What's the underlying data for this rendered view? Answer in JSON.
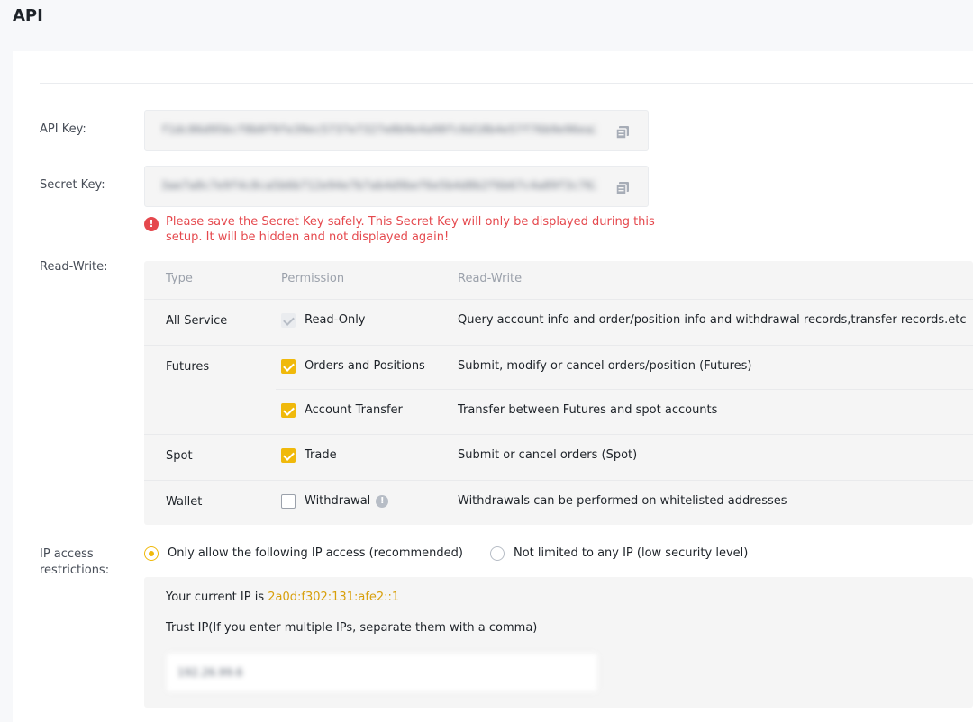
{
  "page": {
    "title": "API"
  },
  "keys": {
    "api_key_label": "API Key:",
    "api_key_value": "f1dc86d95bcf8b0f9fe39ec5737e7327e0b9e4a98fc6d18b4e57f76b9e96ea25",
    "secret_key_label": "Secret Key:",
    "secret_key_value": "3ae7a8c7e9f4c8ca5b6b712e94e7b7ab4d9bef6e5b4d8b2f6b67c4a89f3c7622",
    "warning": "Please save the Secret Key safely. This Secret Key will only be displayed during this setup. It will be hidden and not displayed again!"
  },
  "read_write": {
    "label": "Read-Write:",
    "headers": {
      "type": "Type",
      "permission": "Permission",
      "read_write": "Read-Write"
    },
    "rows": [
      {
        "type": "All Service",
        "permission": "Read-Only",
        "description": "Query account info and order/position info and withdrawal records,transfer records.etc",
        "state": "disabled-checked"
      },
      {
        "type": "Futures",
        "permission": "Orders and Positions",
        "description": "Submit, modify or cancel orders/position (Futures)",
        "state": "checked"
      },
      {
        "type": "",
        "permission": "Account Transfer",
        "description": "Transfer between Futures and spot accounts",
        "state": "checked"
      },
      {
        "type": "Spot",
        "permission": "Trade",
        "description": "Submit or cancel orders (Spot)",
        "state": "checked"
      },
      {
        "type": "Wallet",
        "permission": "Withdrawal",
        "description": "Withdrawals can be performed on whitelisted addresses",
        "state": "unchecked"
      }
    ]
  },
  "ip": {
    "label": "IP access restrictions:",
    "option_restricted": "Only allow the following IP access (recommended)",
    "option_unrestricted": "Not limited to any IP (low security level)",
    "selected": "restricted",
    "current_ip_prefix": "Your current IP is ",
    "current_ip": "2a0d:f302:131:afe2::1",
    "trust_label": "Trust IP(If you enter multiple IPs, separate them with a comma)",
    "trust_value": "192.26.99.6"
  },
  "colors": {
    "accent": "#f0b90b",
    "error": "#e5484d",
    "ip_text": "#d89f0b"
  },
  "icons": {
    "copy": "copy-icon",
    "warning": "exclamation-circle-icon",
    "info": "info-circle-icon"
  }
}
